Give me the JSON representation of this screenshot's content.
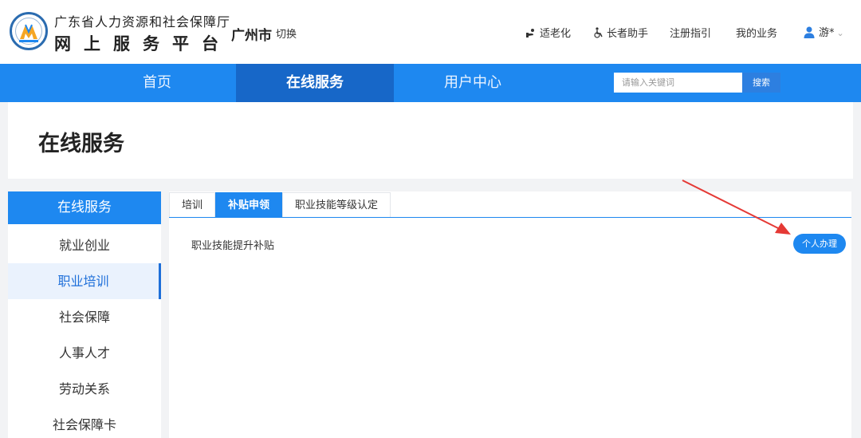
{
  "header": {
    "org_name": "广东省人力资源和社会保障厅",
    "platform_name": "网上服务平台",
    "city": "广州市",
    "switch_label": "切换",
    "links": {
      "aging": "适老化",
      "elder": "长者助手",
      "guide": "注册指引",
      "my_business": "我的业务"
    },
    "user_name": "游*"
  },
  "nav": {
    "items": [
      "首页",
      "在线服务",
      "用户中心"
    ],
    "active": "在线服务",
    "search_placeholder": "请输入关键词",
    "search_button": "搜索"
  },
  "page": {
    "title": "在线服务"
  },
  "sidebar": {
    "title": "在线服务",
    "items": [
      "就业创业",
      "职业培训",
      "社会保障",
      "人事人才",
      "劳动关系",
      "社会保障卡"
    ],
    "active": "职业培训"
  },
  "content": {
    "tabs": [
      "培训",
      "补贴申领",
      "职业技能等级认定"
    ],
    "active_tab": "补贴申领",
    "item_label": "职业技能提升补贴",
    "apply_button": "个人办理"
  },
  "colors": {
    "primary": "#1e88f0",
    "primary_dark": "#1767c8",
    "annotation_arrow": "#e53935"
  }
}
